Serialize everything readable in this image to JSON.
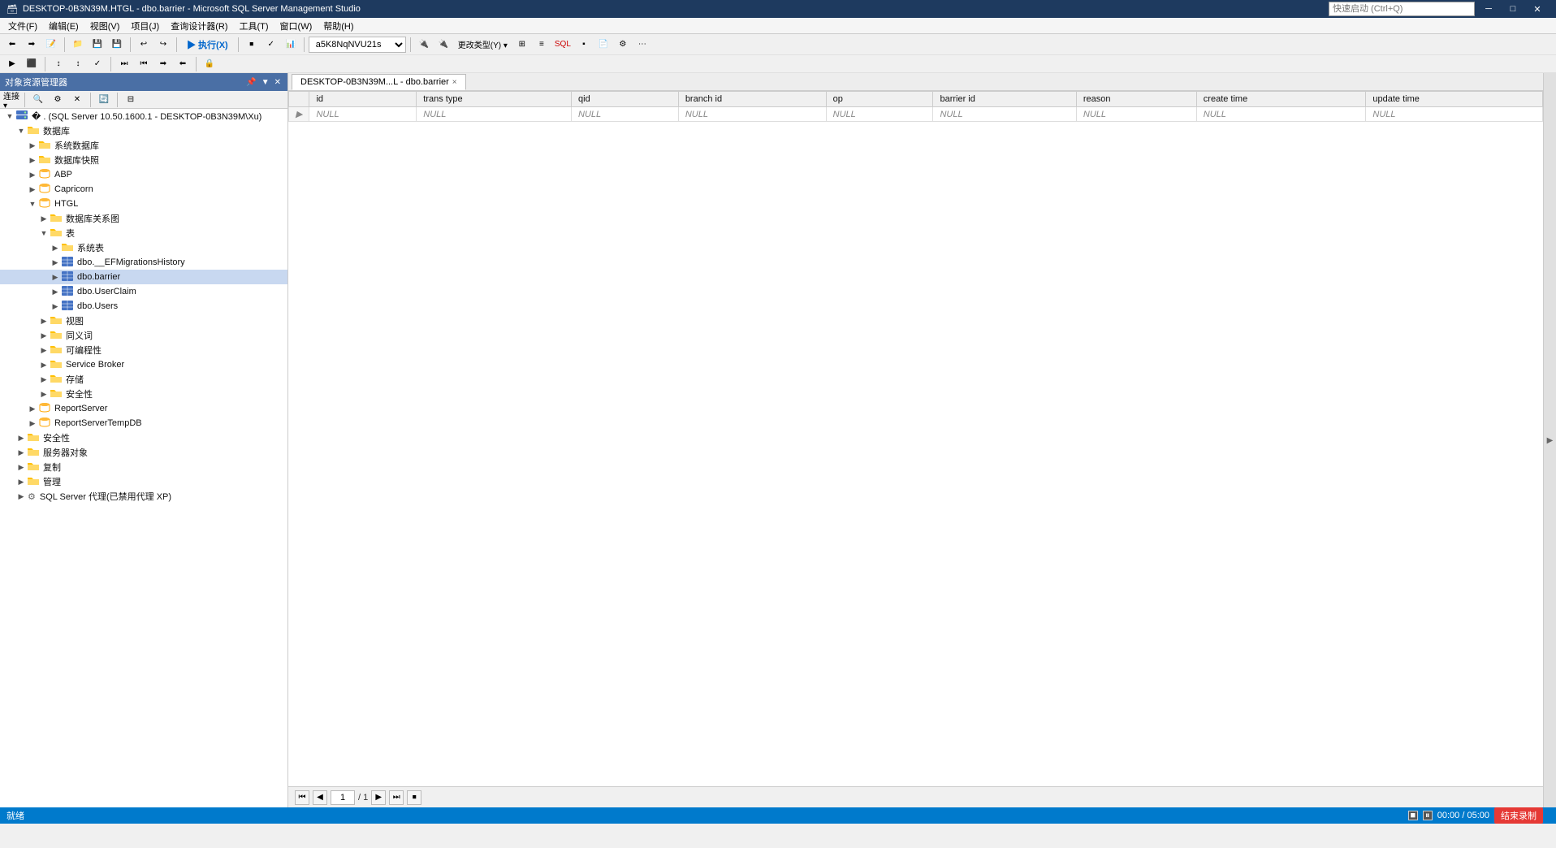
{
  "titlebar": {
    "icon": "🗃",
    "title": "DESKTOP-0B3N39M.HTGL - dbo.barrier - Microsoft SQL Server Management Studio",
    "search_placeholder": "快速启动 (Ctrl+Q)",
    "btn_minimize": "─",
    "btn_restore": "□",
    "btn_close": "✕"
  },
  "menubar": {
    "items": [
      "文件(F)",
      "编辑(E)",
      "视图(V)",
      "项目(J)",
      "查询设计器(R)",
      "工具(T)",
      "窗口(W)",
      "帮助(H)"
    ]
  },
  "toolbar1": {
    "buttons": [
      "⬅",
      "➡",
      "🔄",
      "📁",
      "💾",
      "📋",
      "✂",
      "📄",
      "↩",
      "↪",
      "▶"
    ],
    "execute_label": "▶ 执行(X)"
  },
  "toolbar2": {
    "connection_label": "a5K8NqNVU21s"
  },
  "sidebar": {
    "header": "对象资源管理器",
    "tree": [
      {
        "id": "server",
        "indent": 0,
        "expand": "▼",
        "icon": "server",
        "label": "🔌 . (SQL Server 10.50.1600.1 - DESKTOP-0B3N39M\\Xu)",
        "level": 0
      },
      {
        "id": "databases",
        "indent": 1,
        "expand": "▼",
        "icon": "folder",
        "label": "数据库",
        "level": 1
      },
      {
        "id": "system-dbs",
        "indent": 2,
        "expand": "▶",
        "icon": "folder",
        "label": "系统数据库",
        "level": 2
      },
      {
        "id": "snapshots",
        "indent": 2,
        "expand": "▶",
        "icon": "folder",
        "label": "数据库快照",
        "level": 2
      },
      {
        "id": "abp",
        "indent": 2,
        "expand": "▶",
        "icon": "db",
        "label": "ABP",
        "level": 2
      },
      {
        "id": "capricorn",
        "indent": 2,
        "expand": "▶",
        "icon": "db",
        "label": "Capricorn",
        "level": 2
      },
      {
        "id": "htgl",
        "indent": 2,
        "expand": "▼",
        "icon": "db",
        "label": "HTGL",
        "level": 2
      },
      {
        "id": "htgl-diagram",
        "indent": 3,
        "expand": "▶",
        "icon": "folder",
        "label": "数据库关系图",
        "level": 3
      },
      {
        "id": "htgl-tables",
        "indent": 3,
        "expand": "▼",
        "icon": "folder",
        "label": "表",
        "level": 3
      },
      {
        "id": "htgl-systables",
        "indent": 4,
        "expand": "▶",
        "icon": "folder",
        "label": "系统表",
        "level": 4
      },
      {
        "id": "efmigrations",
        "indent": 4,
        "expand": "▶",
        "icon": "table",
        "label": "dbo.__EFMigrationsHistory",
        "level": 4
      },
      {
        "id": "barrier",
        "indent": 4,
        "expand": "▶",
        "icon": "table",
        "label": "dbo.barrier",
        "level": 4
      },
      {
        "id": "userclaim",
        "indent": 4,
        "expand": "▶",
        "icon": "table",
        "label": "dbo.UserClaim",
        "level": 4
      },
      {
        "id": "users",
        "indent": 4,
        "expand": "▶",
        "icon": "table",
        "label": "dbo.Users",
        "level": 4
      },
      {
        "id": "views",
        "indent": 3,
        "expand": "▶",
        "icon": "folder",
        "label": "视图",
        "level": 3
      },
      {
        "id": "synonyms",
        "indent": 3,
        "expand": "▶",
        "icon": "folder",
        "label": "同义词",
        "level": 3
      },
      {
        "id": "programmability",
        "indent": 3,
        "expand": "▶",
        "icon": "folder",
        "label": "可编程性",
        "level": 3
      },
      {
        "id": "servicebroker",
        "indent": 3,
        "expand": "▶",
        "icon": "folder",
        "label": "Service Broker",
        "level": 3
      },
      {
        "id": "storage",
        "indent": 3,
        "expand": "▶",
        "icon": "folder",
        "label": "存储",
        "level": 3
      },
      {
        "id": "security",
        "indent": 3,
        "expand": "▶",
        "icon": "folder",
        "label": "安全性",
        "level": 3
      },
      {
        "id": "reportserver",
        "indent": 2,
        "expand": "▶",
        "icon": "db",
        "label": "ReportServer",
        "level": 2
      },
      {
        "id": "reportservertempdb",
        "indent": 2,
        "expand": "▶",
        "icon": "db",
        "label": "ReportServerTempDB",
        "level": 2
      },
      {
        "id": "security2",
        "indent": 1,
        "expand": "▶",
        "icon": "folder",
        "label": "安全性",
        "level": 1
      },
      {
        "id": "server-objects",
        "indent": 1,
        "expand": "▶",
        "icon": "folder",
        "label": "服务器对象",
        "level": 1
      },
      {
        "id": "replication",
        "indent": 1,
        "expand": "▶",
        "icon": "folder",
        "label": "复制",
        "level": 1
      },
      {
        "id": "management",
        "indent": 1,
        "expand": "▶",
        "icon": "folder",
        "label": "管理",
        "level": 1
      },
      {
        "id": "sqlagent",
        "indent": 1,
        "expand": "▶",
        "icon": "agent",
        "label": "SQL Server 代理(已禁用代理 XP)",
        "level": 1
      }
    ]
  },
  "tab": {
    "label": "DESKTOP-0B3N39M...L - dbo.barrier",
    "close": "×"
  },
  "grid": {
    "columns": [
      "id",
      "trans type",
      "qid",
      "branch id",
      "op",
      "barrier id",
      "reason",
      "create time",
      "update time"
    ],
    "rows": [
      [
        "NULL",
        "NULL",
        "NULL",
        "NULL",
        "NULL",
        "NULL",
        "NULL",
        "NULL",
        "NULL"
      ]
    ]
  },
  "pagination": {
    "current": "1",
    "total": "1",
    "page_label": "/ 1",
    "first_btn": "⏮",
    "prev_btn": "◀",
    "next_btn": "▶",
    "last_btn": "⏭",
    "stop_btn": "⏹"
  },
  "statusbar": {
    "label": "就绪"
  },
  "recording": {
    "time": "00:00 / 05:00",
    "btn_stop": "■",
    "btn_pause": "⏸",
    "btn_label": "结束录制"
  }
}
